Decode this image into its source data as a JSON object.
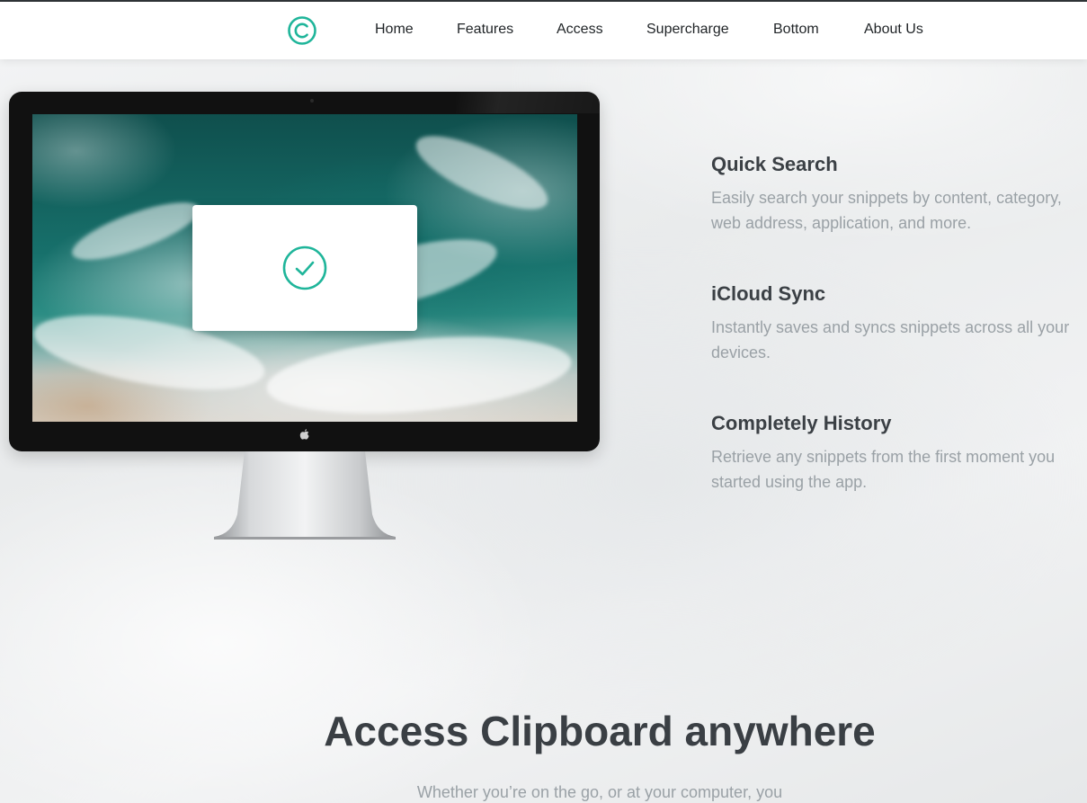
{
  "brand": {
    "logo_icon": "copyright-c-icon",
    "accent_color": "#1fb59a"
  },
  "nav": {
    "items": [
      {
        "label": "Home"
      },
      {
        "label": "Features"
      },
      {
        "label": "Access"
      },
      {
        "label": "Supercharge"
      },
      {
        "label": "Bottom"
      },
      {
        "label": "About Us"
      }
    ]
  },
  "hero": {
    "device": "imac-monitor",
    "dialog_icon": "check-circle-icon"
  },
  "features": [
    {
      "title": "Quick Search",
      "description": "Easily search your snippets by content, category, web address, application, and more."
    },
    {
      "title": "iCloud Sync",
      "description": "Instantly saves and syncs snippets across all your devices."
    },
    {
      "title": "Completely History",
      "description": "Retrieve any snippets from the first moment you started using the app."
    }
  ],
  "access_section": {
    "title": "Access Clipboard anywhere",
    "subtitle": "Whether you’re on the go, or at your computer, you"
  }
}
